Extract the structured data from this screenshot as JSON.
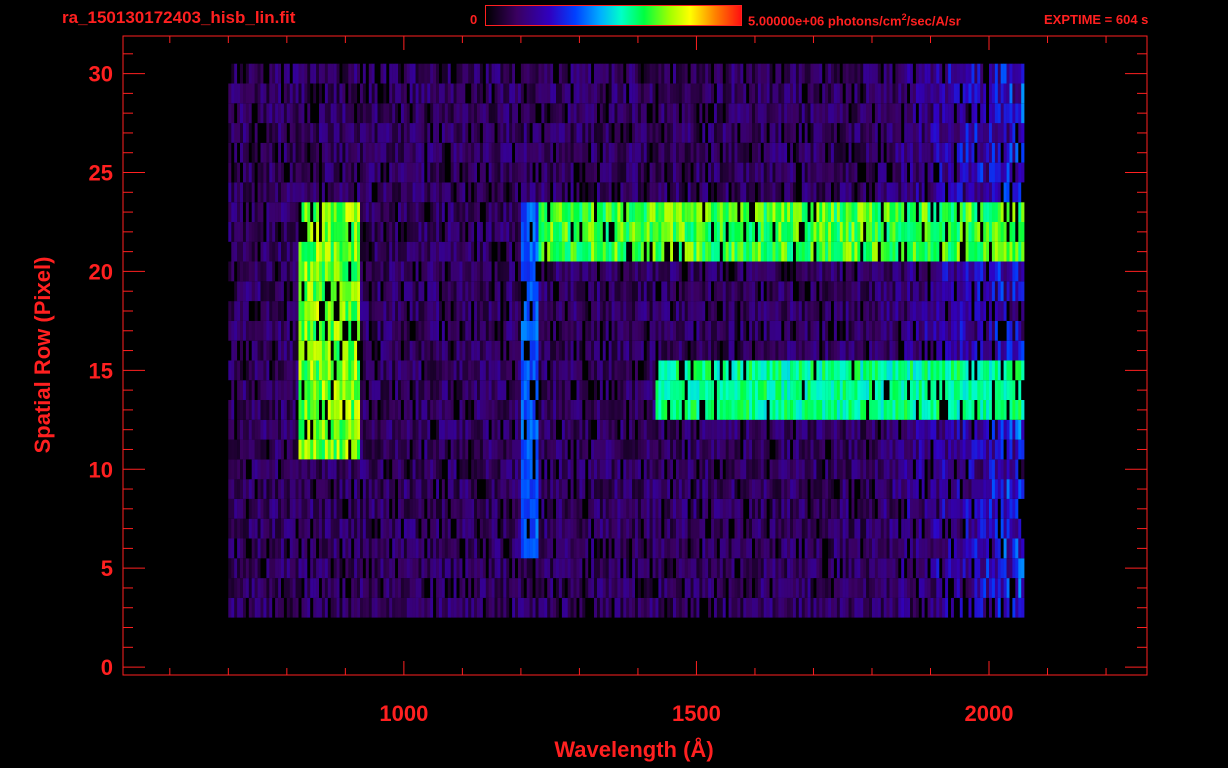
{
  "header": {
    "file_title": "ra_150130172403_hisb_lin.fit",
    "colorbar_min": "0",
    "colorbar_max_label": "5.00000e+06 photons/cm",
    "colorbar_max_exponent": "2",
    "colorbar_max_units": "/sec/A/sr",
    "exptime": "EXPTIME = 604 s"
  },
  "colors": {
    "axis": "#ff2020",
    "background": "#000000",
    "colormap": [
      "#000000",
      "#3a0060",
      "#3000c0",
      "#0040ff",
      "#00b0ff",
      "#00ffc8",
      "#00ff40",
      "#a0ff00",
      "#ffff00",
      "#ff8000",
      "#ff1010"
    ]
  },
  "chart_data": {
    "type": "heatmap",
    "xlabel": "Wavelength (Å)",
    "ylabel": "Spatial Row (Pixel)",
    "xlim": [
      520,
      2270
    ],
    "ylim": [
      -0.4,
      31.9
    ],
    "x_ticks": [
      1000,
      1500,
      2000
    ],
    "y_ticks": [
      0,
      5,
      10,
      15,
      20,
      25,
      30
    ],
    "colorbar": {
      "min": 0,
      "max": 5000000,
      "units": "photons/cm^2/sec/A/sr"
    },
    "data_extent": {
      "x": [
        700,
        2060
      ],
      "rows": [
        3,
        30
      ]
    },
    "features": [
      {
        "x": [
          820,
          920
        ],
        "rows": [
          11,
          23
        ],
        "level": 0.75
      },
      {
        "x": [
          1200,
          1225
        ],
        "rows": [
          6,
          23
        ],
        "level": 0.35
      },
      {
        "x": [
          1230,
          2060
        ],
        "rows": [
          21,
          23
        ],
        "level": 0.7
      },
      {
        "x": [
          1430,
          2060
        ],
        "rows": [
          13,
          15
        ],
        "level": 0.6
      }
    ],
    "grid": false
  }
}
